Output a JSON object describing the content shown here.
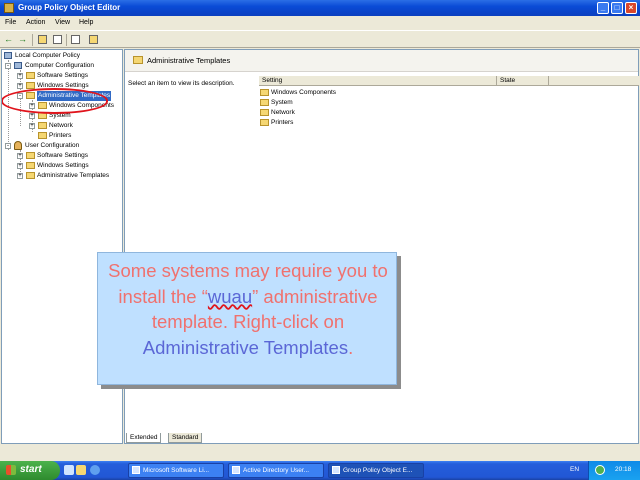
{
  "window": {
    "title": "Group Policy Object Editor",
    "controls": {
      "minimize": "_",
      "maximize": "□",
      "close": "×"
    }
  },
  "menu": [
    "File",
    "Action",
    "View",
    "Help"
  ],
  "toolbar": {
    "back": "←",
    "forward": "→",
    "icons": [
      "up-folder-icon",
      "show-hide-tree-icon",
      "export-list-icon",
      "help-icon"
    ]
  },
  "tree": {
    "root": "Local Computer Policy",
    "computer_configuration": "Computer Configuration",
    "software_settings": "Software Settings",
    "windows_settings": "Windows Settings",
    "administrative_templates": "Administrative Templates",
    "windows_components": "Windows Components",
    "system": "System",
    "network": "Network",
    "printers": "Printers",
    "user_configuration": "User Configuration",
    "user_software_settings": "Software Settings",
    "user_windows_settings": "Windows Settings",
    "user_administrative_templates": "Administrative Templates"
  },
  "right_pane": {
    "header": "Administrative Templates",
    "description": "Select an item to view its description.",
    "columns": [
      "Setting",
      "State"
    ],
    "items": [
      "Windows Components",
      "System",
      "Network",
      "Printers"
    ]
  },
  "tabs": [
    "Extended",
    "Standard"
  ],
  "callout": {
    "part1": "Some systems may require you to install the “",
    "wuau": "wuau",
    "part2": "” administrative template. Right-click on ",
    "target": "Administrative Templates",
    "end": "."
  },
  "taskbar": {
    "start": "start",
    "buttons": [
      "Microsoft Software Li...",
      "Active Directory User...",
      "Group Policy Object E..."
    ],
    "language": "EN",
    "clock": "20:18"
  },
  "colors": {
    "titlebar": "#0a4bd6",
    "callout_bg": "#bfe0ff",
    "callout_text": "#f0716e",
    "callout_highlight": "#5b67d6",
    "annotation_oval": "#e0141c",
    "selection": "#316ac5"
  }
}
